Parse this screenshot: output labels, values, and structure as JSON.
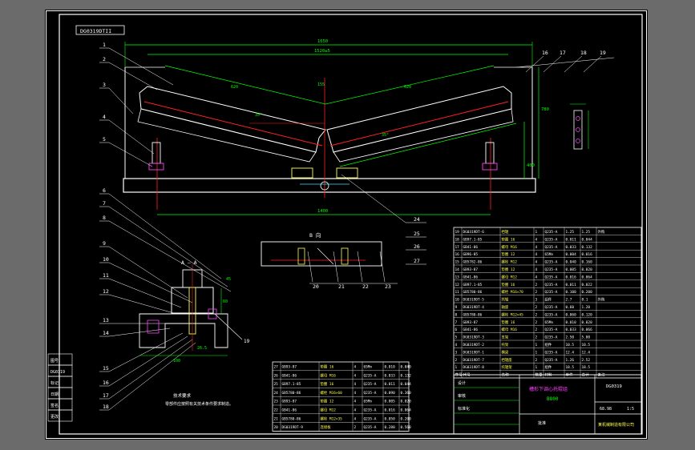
{
  "drawing": {
    "corner_tag": "DG0319DTII",
    "view_label_aa": "A — A",
    "view_label_b": "B 向",
    "notes_title": "技术要求",
    "notes_text": "零部件应按照有关技术条件要求制造。",
    "doc_code": "DG0319"
  },
  "dimensions": {
    "top_overall": "1650",
    "top_inner": "1520±5",
    "bottom_span": "1400",
    "center_height": "780",
    "left_segment": "620",
    "right_segment": "620",
    "angle_left": "35°",
    "angle_right": "35°",
    "right_height": "400",
    "right_height_small": "155",
    "aa_width": "100",
    "aa_offset": "26.5",
    "aa_height": "60",
    "aa_side": "45"
  },
  "callouts_left": [
    "1",
    "2",
    "3",
    "4",
    "5",
    "6",
    "7",
    "8",
    "9",
    "10",
    "11",
    "12",
    "13",
    "14",
    "15",
    "16",
    "17",
    "18"
  ],
  "callouts_top_right": [
    "16",
    "17",
    "18",
    "19"
  ],
  "callouts_mid": [
    "24",
    "25",
    "26",
    "27"
  ],
  "callouts_b_view": [
    "20",
    "21",
    "22",
    "23"
  ],
  "callouts_aa_right": "19",
  "colors": {
    "frame": "#ffffff",
    "outline": "#ffffff",
    "dimension": "#00ff00",
    "centerline": "#ff2020",
    "part": "#ffff55",
    "cyan": "#40e0ff",
    "magenta": "#ff40ff"
  },
  "parts_table": {
    "rows": [
      [
        "19",
        "DG0319DT-6",
        "挡辊",
        "1",
        "Q235-A",
        "1.25",
        "1.25",
        "外购"
      ],
      [
        "18",
        "GB97.1-85",
        "垫圈 16",
        "4",
        "Q235-A",
        "0.011",
        "0.044",
        ""
      ],
      [
        "17",
        "GB41-86",
        "螺母 M16",
        "4",
        "Q235-A",
        "0.033",
        "0.132",
        ""
      ],
      [
        "16",
        "GB96-85",
        "垫圈 12",
        "4",
        "65Mn",
        "0.004",
        "0.016",
        ""
      ],
      [
        "15",
        "GB5782-86",
        "螺栓 M12",
        "4",
        "Q235-A",
        "0.040",
        "0.160",
        ""
      ],
      [
        "14",
        "GB93-87",
        "垫圈 12",
        "4",
        "Q235-A",
        "0.005",
        "0.020",
        ""
      ],
      [
        "13",
        "GB41-86",
        "螺母 M12",
        "4",
        "Q235-A",
        "0.016",
        "0.064",
        ""
      ],
      [
        "12",
        "GB97.1-85",
        "垫圈 16",
        "2",
        "Q235-A",
        "0.011",
        "0.022",
        ""
      ],
      [
        "11",
        "GB5780-86",
        "螺栓 M16×70",
        "2",
        "Q235-A",
        "0.100",
        "0.200",
        ""
      ],
      [
        "10",
        "DG0319DT-5",
        "托辊",
        "3",
        "组件",
        "2.7",
        "8.1",
        "外购"
      ],
      [
        "9",
        "DG0319DT-4",
        "轴座",
        "2",
        "Q235-A",
        "0.60",
        "1.20",
        ""
      ],
      [
        "8",
        "GB5780-86",
        "螺栓 M12×45",
        "2",
        "Q235-A",
        "0.060",
        "0.120",
        ""
      ],
      [
        "7",
        "GB93-87",
        "垫圈 16",
        "2",
        "65Mn",
        "0.010",
        "0.020",
        ""
      ],
      [
        "6",
        "GB41-86",
        "螺母 M16",
        "2",
        "Q235-A",
        "0.033",
        "0.066",
        ""
      ],
      [
        "5",
        "DG0319DT-3",
        "支架",
        "2",
        "Q235-A",
        "2.50",
        "5.00",
        ""
      ],
      [
        "4",
        "DG0319DT-2",
        "托架",
        "1",
        "组件",
        "10.5",
        "10.5",
        ""
      ],
      [
        "3",
        "DG0319DT-1",
        "横梁",
        "1",
        "Q235-A",
        "12.4",
        "12.4",
        ""
      ],
      [
        "2",
        "DG0319DT-7",
        "挡辊座",
        "2",
        "Q235-A",
        "1.26",
        "2.52",
        ""
      ],
      [
        "1",
        "DG0319DT-8",
        "托辊架",
        "1",
        "组件",
        "18.5",
        "18.5",
        ""
      ]
    ],
    "header": [
      "序号",
      "代号",
      "名称",
      "数量",
      "材料",
      "单件",
      "总计",
      "备注"
    ]
  },
  "parts_table_2": {
    "rows": [
      [
        "27",
        "GB93-87",
        "垫圈 16",
        "4",
        "65Mn",
        "0.010",
        "0.040"
      ],
      [
        "26",
        "GB41-86",
        "螺母 M16",
        "4",
        "Q235-A",
        "0.033",
        "0.132"
      ],
      [
        "25",
        "GB97.1-85",
        "垫圈 16",
        "4",
        "Q235-A",
        "0.011",
        "0.044"
      ],
      [
        "24",
        "GB5780-86",
        "螺栓 M16×60",
        "4",
        "Q235-A",
        "0.090",
        "0.360"
      ],
      [
        "23",
        "GB93-87",
        "垫圈 12",
        "4",
        "65Mn",
        "0.005",
        "0.020"
      ],
      [
        "22",
        "GB41-86",
        "螺母 M12",
        "4",
        "Q235-A",
        "0.016",
        "0.064"
      ],
      [
        "21",
        "GB5780-86",
        "螺栓 M12×35",
        "4",
        "Q235-A",
        "0.050",
        "0.200"
      ],
      [
        "20",
        "DG0319DT-9",
        "连接板",
        "2",
        "Q235-A",
        "0.280",
        "0.560"
      ]
    ]
  },
  "title_block": {
    "name_line1": "槽形下调心托辊组",
    "name_line2": "B800",
    "code": "DG0319",
    "scale": "1:5",
    "weight": "68.98",
    "company": "某机械制造有限公司",
    "role_design": "设计",
    "role_check": "审核",
    "role_approve": "批准",
    "role_standard": "标准化"
  },
  "side_stamp": [
    "图号",
    "DG0319",
    "标记",
    "日期",
    "签名",
    "更改"
  ]
}
